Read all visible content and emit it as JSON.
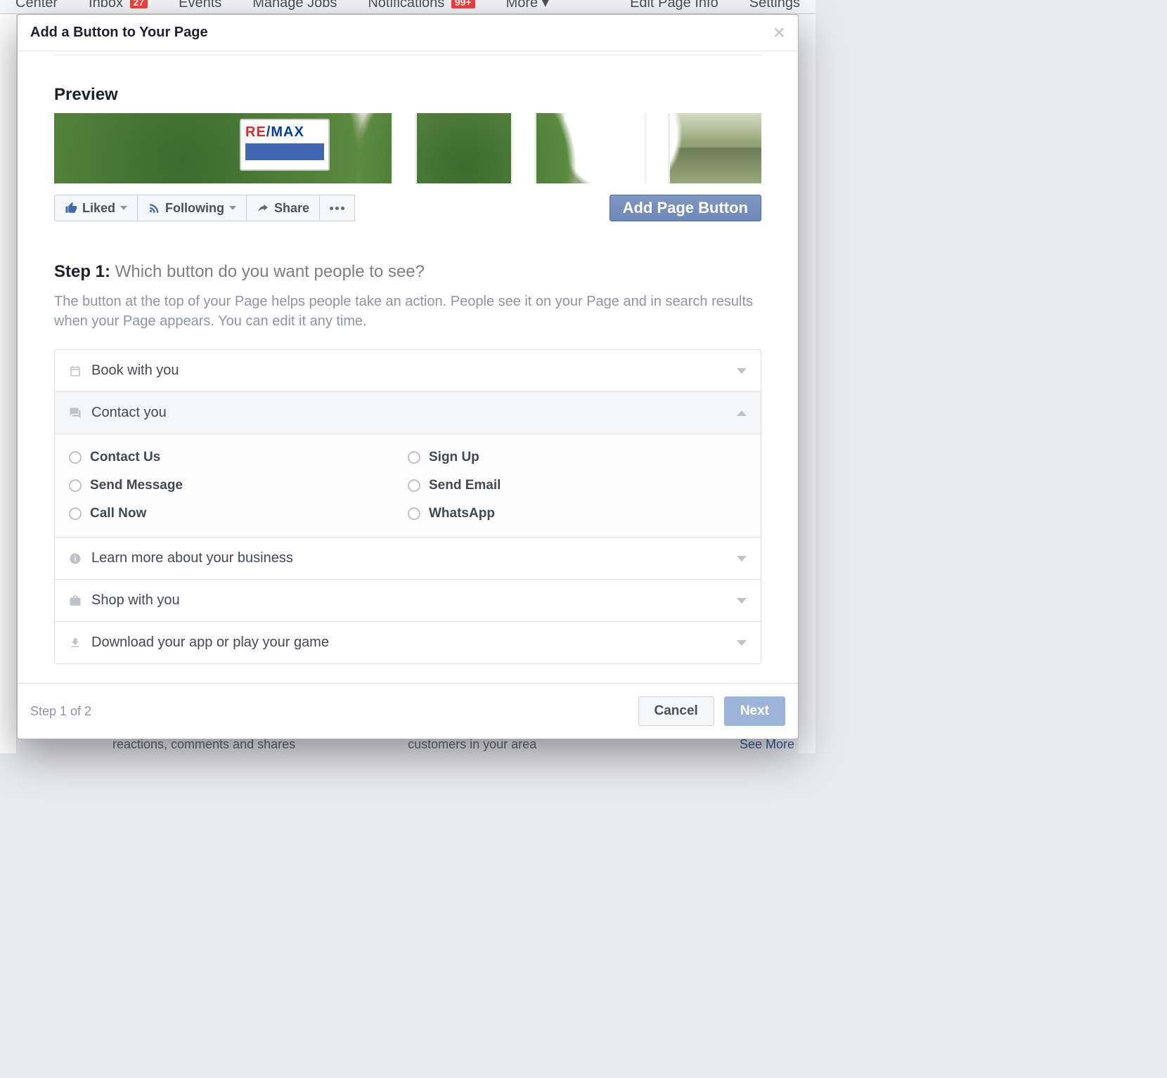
{
  "bgnav": {
    "items": [
      "Center",
      "Inbox",
      "Events",
      "Manage Jobs",
      "Notifications",
      "More ▾"
    ],
    "inbox_badge": "27",
    "notif_badge": "99+",
    "right": [
      "Edit Page Info",
      "Settings"
    ]
  },
  "bg_bottom": {
    "left": "reactions, comments and shares",
    "right": "customers in your area",
    "seemore": "See More"
  },
  "modal": {
    "title": "Add a Button to Your Page",
    "preview_heading": "Preview",
    "sign_text": {
      "re": "RE",
      "slash": "/",
      "max": "MAX"
    },
    "liked": "Liked",
    "following": "Following",
    "share": "Share",
    "add_page_button": "Add Page Button",
    "step_label": "Step 1:",
    "step_question": "Which button do you want people to see?",
    "step_desc": "The button at the top of your Page helps people take an action. People see it on your Page and in search results when your Page appears. You can edit it any time.",
    "categories": {
      "book": "Book with you",
      "contact": "Contact you",
      "learn": "Learn more about your business",
      "shop": "Shop with you",
      "download": "Download your app or play your game"
    },
    "contact_options": {
      "contact_us": "Contact Us",
      "sign_up": "Sign Up",
      "send_message": "Send Message",
      "send_email": "Send Email",
      "call_now": "Call Now",
      "whatsapp": "WhatsApp"
    },
    "footer_step": "Step 1 of 2",
    "cancel": "Cancel",
    "next": "Next"
  }
}
